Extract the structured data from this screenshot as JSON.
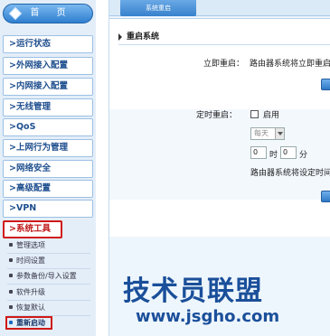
{
  "sidebar": {
    "home_label": "首 页",
    "items": [
      {
        "label": "运行状态"
      },
      {
        "label": "外网接入配置"
      },
      {
        "label": "内网接入配置"
      },
      {
        "label": "无线管理"
      },
      {
        "label": "QoS"
      },
      {
        "label": "上网行为管理"
      },
      {
        "label": "网络安全"
      },
      {
        "label": "高级配置"
      },
      {
        "label": "VPN"
      },
      {
        "label": "系统工具"
      }
    ],
    "caret": ">",
    "sub_items": [
      {
        "label": "管理选项"
      },
      {
        "label": "时间设置"
      },
      {
        "label": "参数备份/导入设置"
      },
      {
        "label": "软件升级"
      },
      {
        "label": "恢复默认"
      },
      {
        "label": "重新启动"
      }
    ]
  },
  "main": {
    "tab_label": "系统重启",
    "section_title": "重启系统",
    "reboot_now": {
      "label": "立即重启：",
      "text": "路由器系统将立即重启"
    },
    "scheduled": {
      "label": "定时重启：",
      "enable_label": "启用",
      "day_select": "每天",
      "hour_value": "0",
      "hour_unit": "时",
      "minute_value": "0",
      "minute_unit": "分",
      "text": "路由器系统将设定时间"
    }
  },
  "watermark": {
    "logo_text": "技术员联盟",
    "url": "www.jsgho.com"
  }
}
